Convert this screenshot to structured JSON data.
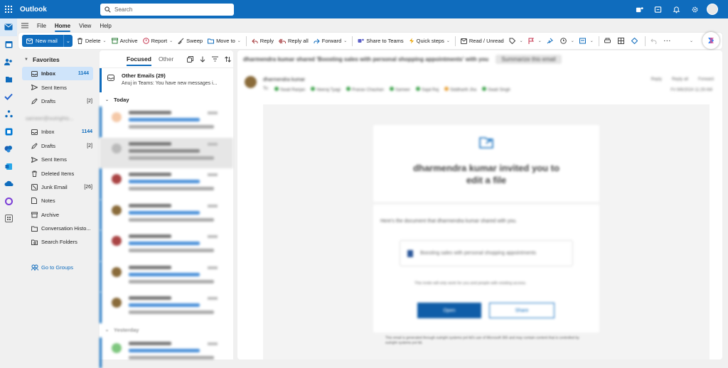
{
  "app": {
    "title": "Outlook"
  },
  "search": {
    "placeholder": "Search"
  },
  "menu": {
    "file": "File",
    "home": "Home",
    "view": "View",
    "help": "Help"
  },
  "ribbon": {
    "new_mail": "New mail",
    "delete": "Delete",
    "archive": "Archive",
    "report": "Report",
    "sweep": "Sweep",
    "move_to": "Move to",
    "reply": "Reply",
    "reply_all": "Reply all",
    "forward": "Forward",
    "share_to_teams": "Share to Teams",
    "quick_steps": "Quick steps",
    "read_unread": "Read / Unread"
  },
  "folders": {
    "favorites_header": "Favorites",
    "favorites": [
      {
        "label": "Inbox",
        "count": "1144"
      },
      {
        "label": "Sent Items",
        "count": ""
      },
      {
        "label": "Drafts",
        "count": "[2]"
      }
    ],
    "account": "sameer@outrights...",
    "account_items": [
      {
        "label": "Inbox",
        "count": "1144"
      },
      {
        "label": "Drafts",
        "count": "[2]"
      },
      {
        "label": "Sent Items",
        "count": ""
      },
      {
        "label": "Deleted Items",
        "count": ""
      },
      {
        "label": "Junk Email",
        "count": "[26]"
      },
      {
        "label": "Notes",
        "count": ""
      },
      {
        "label": "Archive",
        "count": ""
      },
      {
        "label": "Conversation Histo...",
        "count": ""
      },
      {
        "label": "Search Folders",
        "count": ""
      }
    ],
    "go_to_groups": "Go to Groups"
  },
  "message_list": {
    "tab_focused": "Focused",
    "tab_other": "Other",
    "other_emails_title": "Other Emails (29)",
    "other_emails_preview": "Anuj in Teams: You have new messages i...",
    "group_today": "Today",
    "group_yesterday": "Yesterday"
  },
  "reading": {
    "subject": "dharmendra kumar shared 'Boosting sales with personal shopping appointments' with you",
    "summarize": "Summarize this email",
    "from": "dharmendra kumar",
    "to_label": "To:",
    "recipients": [
      "Swati Ranjan",
      "Neeraj Tyagi",
      "Pranav Chauhan",
      "Sameer",
      "Sajal Raj",
      "Siddharth Jha",
      "Swati Singh"
    ],
    "date": "Fri 9/6/2024 11:29 AM",
    "action_reply": "Reply",
    "action_reply_all": "Reply all",
    "action_forward": "Forward",
    "card_heading_1": "dharmendra kumar invited you to",
    "card_heading_2": "edit a file",
    "card_text": "Here's the document that dharmendra kumar shared with you.",
    "doc_name": "Boosting sales with personal shopping appointments",
    "note": "This invite will only work for you and people with existing access.",
    "open_button": "Open",
    "share_button": "Share",
    "footer": "This email is generated through outright systems pvt ltd's use of Microsoft 365 and may contain content that is controlled by outright systems pvt ltd."
  }
}
